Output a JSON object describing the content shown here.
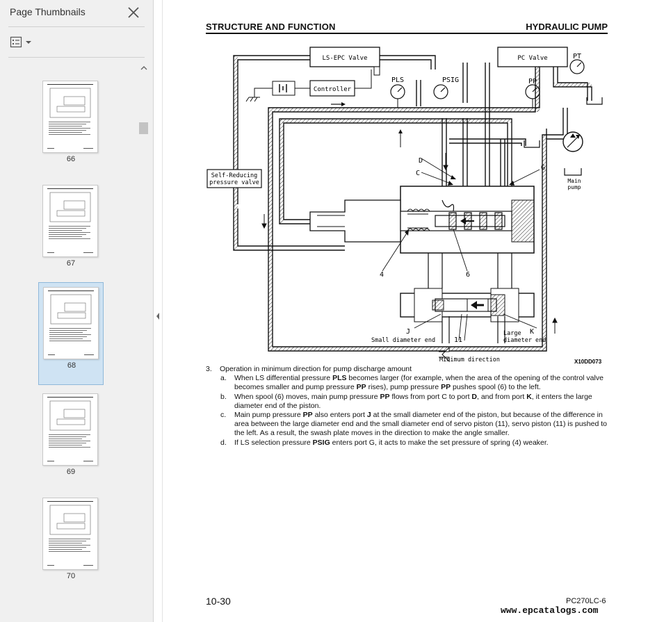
{
  "sidebar": {
    "title": "Page Thumbnails",
    "thumbnails": [
      {
        "page": "66",
        "selected": false
      },
      {
        "page": "67",
        "selected": false
      },
      {
        "page": "68",
        "selected": true
      },
      {
        "page": "69",
        "selected": false
      },
      {
        "page": "70",
        "selected": false
      }
    ]
  },
  "document": {
    "header_left": "STRUCTURE AND FUNCTION",
    "header_right": "HYDRAULIC PUMP",
    "diagram": {
      "labels": {
        "ls_epc": "LS-EPC Valve",
        "pc_valve": "PC Valve",
        "pt": "PT",
        "pls": "PLS",
        "psig": "PSIG",
        "pp": "PP",
        "controller": "Controller",
        "self_reducing_1": "Self-Reducing",
        "self_reducing_2": "pressure valve",
        "d": "D",
        "c": "C",
        "g": "G",
        "main_pump_1": "Main",
        "main_pump_2": "pump",
        "num4": "4",
        "num6": "6",
        "j": "J",
        "k": "K",
        "num11": "11",
        "small_end": "Small diameter end",
        "large_1": "Large",
        "large_2": "diameter end",
        "min_dir": "Minimum direction",
        "fig_id": "X10DD073"
      }
    },
    "item_number": "3.",
    "item_title": "Operation in minimum direction for pump discharge amount",
    "subitems": [
      {
        "mark": "a.",
        "parts": [
          {
            "t": "When LS differential pressure    ",
            "b": false
          },
          {
            "t": "PLS",
            "b": true
          },
          {
            "t": " becomes larger (for example, when the area of the opening of the control valve becomes smaller and pump pressure ",
            "b": false
          },
          {
            "t": "PP",
            "b": true
          },
          {
            "t": " rises), pump pressure ",
            "b": false
          },
          {
            "t": "PP",
            "b": true
          },
          {
            "t": " pushes spool (6) to the left.",
            "b": false
          }
        ]
      },
      {
        "mark": "b.",
        "parts": [
          {
            "t": "When spool (6) moves, main pump pressure ",
            "b": false
          },
          {
            "t": "PP",
            "b": true
          },
          {
            "t": " flows from port C to port ",
            "b": false
          },
          {
            "t": "D",
            "b": true
          },
          {
            "t": ", and from port ",
            "b": false
          },
          {
            "t": "K",
            "b": true
          },
          {
            "t": ", it enters the large diameter end of the piston.",
            "b": false
          }
        ]
      },
      {
        "mark": "c.",
        "parts": [
          {
            "t": "Main pump pressure ",
            "b": false
          },
          {
            "t": "PP",
            "b": true
          },
          {
            "t": " also enters port ",
            "b": false
          },
          {
            "t": "J",
            "b": true
          },
          {
            "t": " at the small diameter end of the piston, but because of the difference in area between the large diameter end and the small diameter end of servo piston (11), servo piston (11) is pushed to the left.  As a result, the swash plate moves in the direction to make the angle smaller.",
            "b": false
          }
        ]
      },
      {
        "mark": "d.",
        "parts": [
          {
            "t": "If LS selection pressure ",
            "b": false
          },
          {
            "t": "PSIG",
            "b": true
          },
          {
            "t": " enters port G, it acts to make the set pressure of spring (4) weaker.",
            "b": false
          }
        ]
      }
    ],
    "footer_left": "10-30",
    "footer_right": "PC270LC-6",
    "watermark": "www.epcatalogs.com"
  }
}
